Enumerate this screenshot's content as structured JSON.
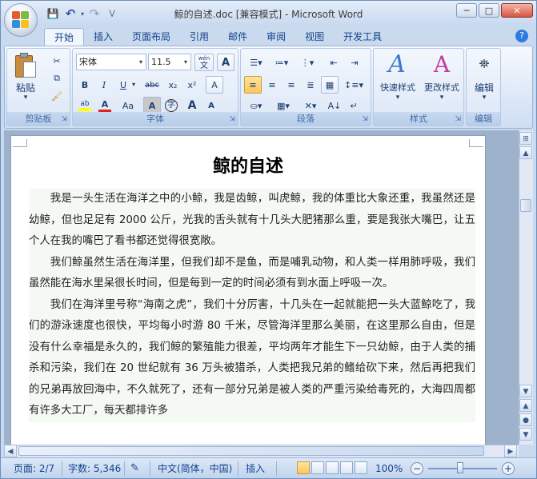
{
  "window": {
    "title": "鲸的自述.doc [兼容模式] - Microsoft Word",
    "controls": {
      "minimize": "─",
      "maximize": "□",
      "close": "✕"
    }
  },
  "qat": {
    "save": "💾",
    "undo": "↶",
    "redo": "↷",
    "customize": "⋁"
  },
  "tabs": [
    "开始",
    "插入",
    "页面布局",
    "引用",
    "邮件",
    "审阅",
    "视图",
    "开发工具"
  ],
  "ribbon": {
    "clipboard": {
      "label": "剪贴板",
      "paste": "粘贴",
      "paste_arrow": "▾"
    },
    "font": {
      "label": "字体",
      "font_name": "宋体",
      "font_size": "11.5",
      "bold": "B",
      "italic": "I",
      "underline": "U",
      "strike": "abc",
      "subscript": "x₂",
      "superscript": "x²",
      "case": "Aa",
      "char_border": "A",
      "enclose": "字",
      "grow": "A",
      "shrink": "A",
      "clear": "A",
      "phonetic": "wén",
      "border_a": "A"
    },
    "paragraph": {
      "label": "段落"
    },
    "styles": {
      "label": "样式",
      "quick": "快速样式",
      "change": "更改样式"
    },
    "editing": {
      "label": "编辑",
      "button": "编辑"
    }
  },
  "document": {
    "title": "鲸的自述",
    "paragraphs": [
      "我是一头生活在海洋之中的小鲸，我是齿鲸，叫虎鲸，我的体重比大象还重，我虽然还是幼鲸，但也足足有 2000 公斤，光我的舌头就有十几头大肥猪那么重，要是我张大嘴巴，让五个人在我的嘴巴了看书都还觉得很宽敞。",
      "我们鲸虽然生活在海洋里，但我们却不是鱼，而是哺乳动物，和人类一样用肺呼吸，我们虽然能在海水里呆很长时间，但是每到一定的时间必须有到水面上呼吸一次。",
      "我们在海洋里号称“海南之虎”，我们十分厉害，十几头在一起就能把一头大蓝鲸吃了，我们的游泳速度也很快，平均每小时游 80 千米，尽管海洋里那么美丽，在这里那么自由，但是没有什么幸福是永久的，我们鲸的繁殖能力很差，平均两年才能生下一只幼鲸，由于人类的捕杀和污染，我们在 20 世纪就有 36 万头被猎杀，人类把我兄弟的鳍给砍下来，然后再把我们的兄弟再放回海中，不久就死了，还有一部分兄弟是被人类的严重污染给毒死的，大海四周都有许多大工厂，每天都排许多"
    ]
  },
  "status": {
    "page": "页面: 2/7",
    "words": "字数: 5,346",
    "language": "中文(简体，中国)",
    "mode": "插入",
    "zoom": "100%",
    "zoom_out": "−",
    "zoom_in": "+"
  }
}
